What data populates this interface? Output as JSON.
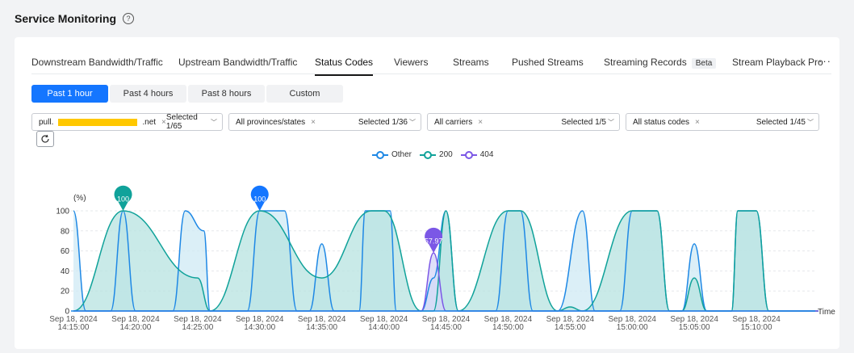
{
  "page": {
    "title": "Service Monitoring"
  },
  "tabs": [
    {
      "label": "Downstream Bandwidth/Traffic",
      "active": false
    },
    {
      "label": "Upstream Bandwidth/Traffic",
      "active": false
    },
    {
      "label": "Status Codes",
      "active": true
    },
    {
      "label": "Viewers",
      "active": false
    },
    {
      "label": "Streams",
      "active": false
    },
    {
      "label": "Pushed Streams",
      "active": false
    },
    {
      "label": "Streaming Records",
      "active": false,
      "badge": "Beta"
    },
    {
      "label": "Stream Playback Pro",
      "active": false
    }
  ],
  "more_label": "···",
  "time_ranges": [
    {
      "label": "Past 1 hour",
      "active": true
    },
    {
      "label": "Past 4 hours",
      "active": false
    },
    {
      "label": "Past 8 hours",
      "active": false
    },
    {
      "label": "Custom",
      "active": false
    }
  ],
  "filters": {
    "domain": {
      "prefix": "pull.",
      "suffix": ".net",
      "selected": "Selected 1/65"
    },
    "province": {
      "tag": "All provinces/states",
      "selected": "Selected 1/36"
    },
    "carrier": {
      "tag": "All carriers",
      "selected": "Selected 1/5"
    },
    "status": {
      "tag": "All status codes",
      "selected": "Selected 1/45"
    }
  },
  "tag_close": "×",
  "chevron": "﹀",
  "colors": {
    "accent": "#1476ff",
    "redacted": "#ffc800"
  },
  "chart_data": {
    "type": "area",
    "ylabel": "(%)",
    "xlabel": "Time",
    "ylim": [
      0,
      100
    ],
    "yticks": [
      0,
      20,
      40,
      60,
      80,
      100
    ],
    "xlim": [
      0,
      60
    ],
    "grid": true,
    "legend_position": "top-center",
    "x_ticks": [
      {
        "x": 0,
        "line1": "Sep 18, 2024",
        "line2": "14:15:00"
      },
      {
        "x": 5,
        "line1": "Sep 18, 2024",
        "line2": "14:20:00"
      },
      {
        "x": 10,
        "line1": "Sep 18, 2024",
        "line2": "14:25:00"
      },
      {
        "x": 15,
        "line1": "Sep 18, 2024",
        "line2": "14:30:00"
      },
      {
        "x": 20,
        "line1": "Sep 18, 2024",
        "line2": "14:35:00"
      },
      {
        "x": 25,
        "line1": "Sep 18, 2024",
        "line2": "14:40:00"
      },
      {
        "x": 30,
        "line1": "Sep 18, 2024",
        "line2": "14:45:00"
      },
      {
        "x": 35,
        "line1": "Sep 18, 2024",
        "line2": "14:50:00"
      },
      {
        "x": 40,
        "line1": "Sep 18, 2024",
        "line2": "14:55:00"
      },
      {
        "x": 45,
        "line1": "Sep 18, 2024",
        "line2": "15:00:00"
      },
      {
        "x": 50,
        "line1": "Sep 18, 2024",
        "line2": "15:05:00"
      },
      {
        "x": 55,
        "line1": "Sep 18, 2024",
        "line2": "15:10:00"
      }
    ],
    "series": [
      {
        "name": "Other",
        "color": "#1e88e5",
        "fill": "#cfeaf4",
        "points": [
          [
            0,
            100
          ],
          [
            1,
            0
          ],
          [
            3,
            0
          ],
          [
            4,
            100
          ],
          [
            5,
            0
          ],
          [
            8,
            0
          ],
          [
            9,
            100
          ],
          [
            10.5,
            80
          ],
          [
            11,
            0
          ],
          [
            14,
            0
          ],
          [
            15,
            100
          ],
          [
            16,
            100
          ],
          [
            17,
            100
          ],
          [
            18,
            0
          ],
          [
            19,
            0
          ],
          [
            20,
            67
          ],
          [
            21,
            0
          ],
          [
            23,
            0
          ],
          [
            23.5,
            100
          ],
          [
            25.5,
            100
          ],
          [
            26,
            0
          ],
          [
            28,
            0
          ],
          [
            29,
            33
          ],
          [
            30,
            100
          ],
          [
            31,
            0
          ],
          [
            34,
            0
          ],
          [
            35,
            100
          ],
          [
            36,
            100
          ],
          [
            37,
            0
          ],
          [
            39,
            0
          ],
          [
            41,
            100
          ],
          [
            42,
            0
          ],
          [
            44,
            0
          ],
          [
            45,
            100
          ],
          [
            46,
            100
          ],
          [
            47,
            100
          ],
          [
            48,
            0
          ],
          [
            49,
            0
          ],
          [
            50,
            67
          ],
          [
            51,
            0
          ],
          [
            53,
            0
          ],
          [
            53.5,
            100
          ],
          [
            55,
            100
          ],
          [
            56,
            0
          ],
          [
            60,
            0
          ]
        ]
      },
      {
        "name": "200",
        "color": "#10a29a",
        "fill": "#b7e3e0",
        "points": [
          [
            0,
            0
          ],
          [
            4,
            100
          ],
          [
            10,
            33
          ],
          [
            11,
            0
          ],
          [
            15,
            100
          ],
          [
            20,
            33
          ],
          [
            24,
            100
          ],
          [
            25,
            100
          ],
          [
            28,
            0
          ],
          [
            29,
            0
          ],
          [
            30,
            100
          ],
          [
            31,
            0
          ],
          [
            35,
            100
          ],
          [
            36,
            100
          ],
          [
            39,
            0
          ],
          [
            40,
            4
          ],
          [
            41,
            0
          ],
          [
            45,
            100
          ],
          [
            46,
            100
          ],
          [
            47,
            100
          ],
          [
            48,
            0
          ],
          [
            49,
            0
          ],
          [
            50,
            33
          ],
          [
            51,
            0
          ],
          [
            53,
            0
          ],
          [
            53.5,
            100
          ],
          [
            55,
            100
          ],
          [
            56,
            0
          ],
          [
            60,
            0
          ]
        ]
      },
      {
        "name": "404",
        "color": "#7b57e6",
        "fill": "#d4d6f7",
        "points": [
          [
            0,
            0
          ],
          [
            28,
            0
          ],
          [
            29,
            57.97
          ],
          [
            30,
            0
          ],
          [
            60,
            0
          ]
        ]
      }
    ],
    "markers": [
      {
        "x": 4,
        "y": 100,
        "label": "100",
        "color": "#10a29a"
      },
      {
        "x": 15,
        "y": 100,
        "label": "100",
        "color": "#1476ff"
      },
      {
        "x": 29,
        "y": 57.97,
        "label": "57.97",
        "color": "#7b57e6"
      }
    ]
  }
}
